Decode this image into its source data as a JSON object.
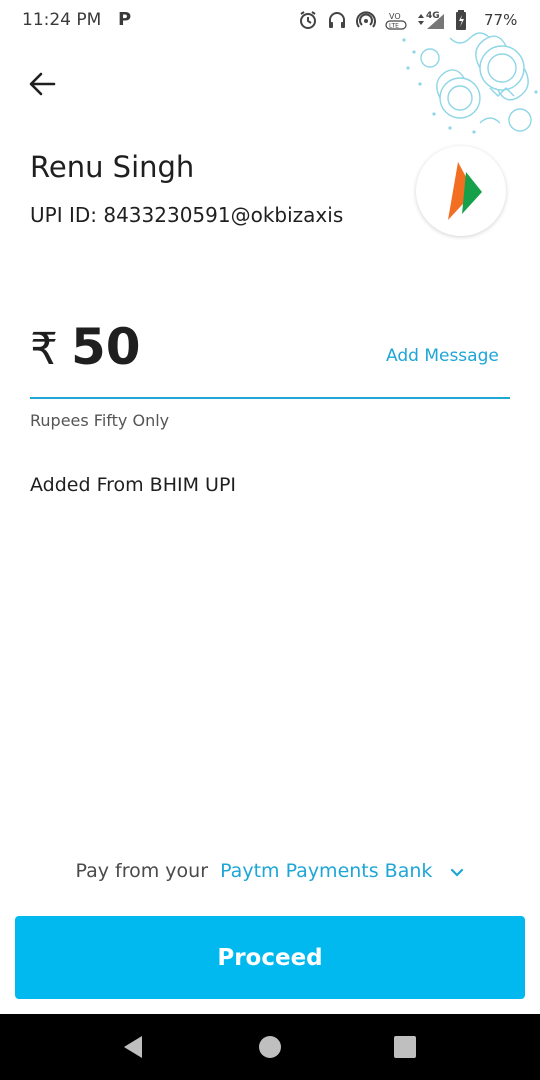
{
  "status_bar": {
    "time": "11:24 PM",
    "app_badge": "P",
    "network": "4G",
    "battery": "77%"
  },
  "header": {
    "payee_name": "Renu Singh",
    "upi_id": "UPI ID: 8433230591@okbizaxis"
  },
  "amount": {
    "currency_symbol": "₹",
    "value": "50",
    "in_words": "Rupees Fifty Only",
    "add_message_label": "Add Message"
  },
  "note": "Added From BHIM UPI",
  "payment_source": {
    "label": "Pay from your",
    "bank": "Paytm Payments Bank"
  },
  "proceed_label": "Proceed",
  "colors": {
    "accent": "#1ea6d7",
    "button": "#02b9ef"
  }
}
